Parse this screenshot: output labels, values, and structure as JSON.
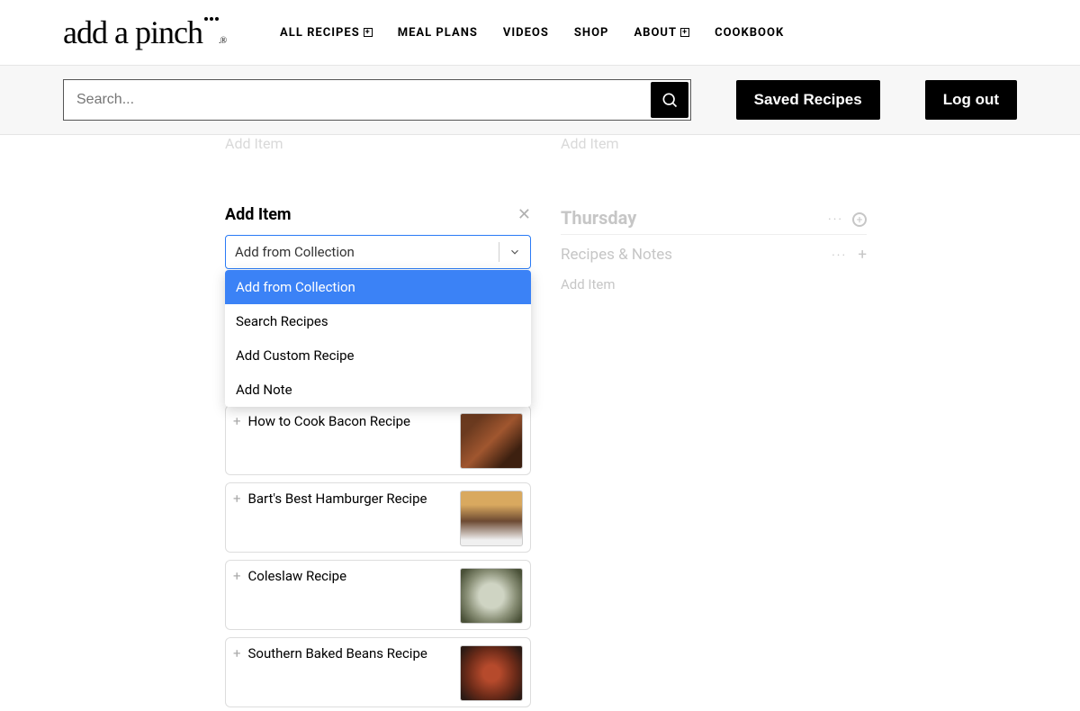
{
  "header": {
    "logo_text": "add a pinch",
    "nav": [
      {
        "label": "ALL RECIPES",
        "has_submenu": true
      },
      {
        "label": "MEAL PLANS",
        "has_submenu": false
      },
      {
        "label": "VIDEOS",
        "has_submenu": false
      },
      {
        "label": "SHOP",
        "has_submenu": false
      },
      {
        "label": "ABOUT",
        "has_submenu": true
      },
      {
        "label": "COOKBOOK",
        "has_submenu": false
      }
    ]
  },
  "searchbar": {
    "placeholder": "Search...",
    "saved_recipes_label": "Saved Recipes",
    "logout_label": "Log out"
  },
  "faded": {
    "add_item_left": "Add Item",
    "add_item_right": "Add Item"
  },
  "right_col": {
    "day": "Thursday",
    "recipes_notes": "Recipes & Notes",
    "add_item": "Add Item"
  },
  "modal": {
    "title": "Add Item",
    "selected_value": "Add from Collection",
    "options": [
      "Add from Collection",
      "Search Recipes",
      "Add Custom Recipe",
      "Add Note"
    ]
  },
  "recipes": [
    {
      "title": "How to Cook Bacon Recipe"
    },
    {
      "title": "Bart's Best Hamburger Recipe"
    },
    {
      "title": "Coleslaw Recipe"
    },
    {
      "title": "Southern Baked Beans Recipe"
    }
  ]
}
